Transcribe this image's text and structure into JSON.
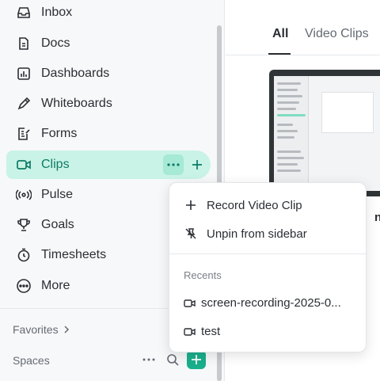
{
  "sidebar": {
    "items": [
      {
        "label": "Inbox",
        "icon": "inbox-icon"
      },
      {
        "label": "Docs",
        "icon": "docs-icon"
      },
      {
        "label": "Dashboards",
        "icon": "dashboards-icon"
      },
      {
        "label": "Whiteboards",
        "icon": "whiteboards-icon"
      },
      {
        "label": "Forms",
        "icon": "forms-icon"
      },
      {
        "label": "Clips",
        "icon": "video-icon",
        "active": true
      },
      {
        "label": "Pulse",
        "icon": "pulse-icon"
      },
      {
        "label": "Goals",
        "icon": "trophy-icon"
      },
      {
        "label": "Timesheets",
        "icon": "timer-icon"
      },
      {
        "label": "More",
        "icon": "more-icon"
      }
    ],
    "favorites_label": "Favorites",
    "spaces_label": "Spaces"
  },
  "main": {
    "tabs": [
      {
        "label": "All",
        "active": true
      },
      {
        "label": "Video Clips",
        "active": false
      }
    ],
    "clip_title_fragment": "ng"
  },
  "menu": {
    "items": [
      {
        "label": "Record Video Clip",
        "icon": "plus-icon"
      },
      {
        "label": "Unpin from sidebar",
        "icon": "unpin-icon"
      }
    ],
    "recents_header": "Recents",
    "recents": [
      {
        "label": "screen-recording-2025-0...",
        "icon": "video-icon"
      },
      {
        "label": "test",
        "icon": "video-icon"
      }
    ]
  },
  "colors": {
    "accent": "#1aaf8b",
    "active_bg": "#c9f3e6",
    "active_text": "#0c7b66"
  }
}
